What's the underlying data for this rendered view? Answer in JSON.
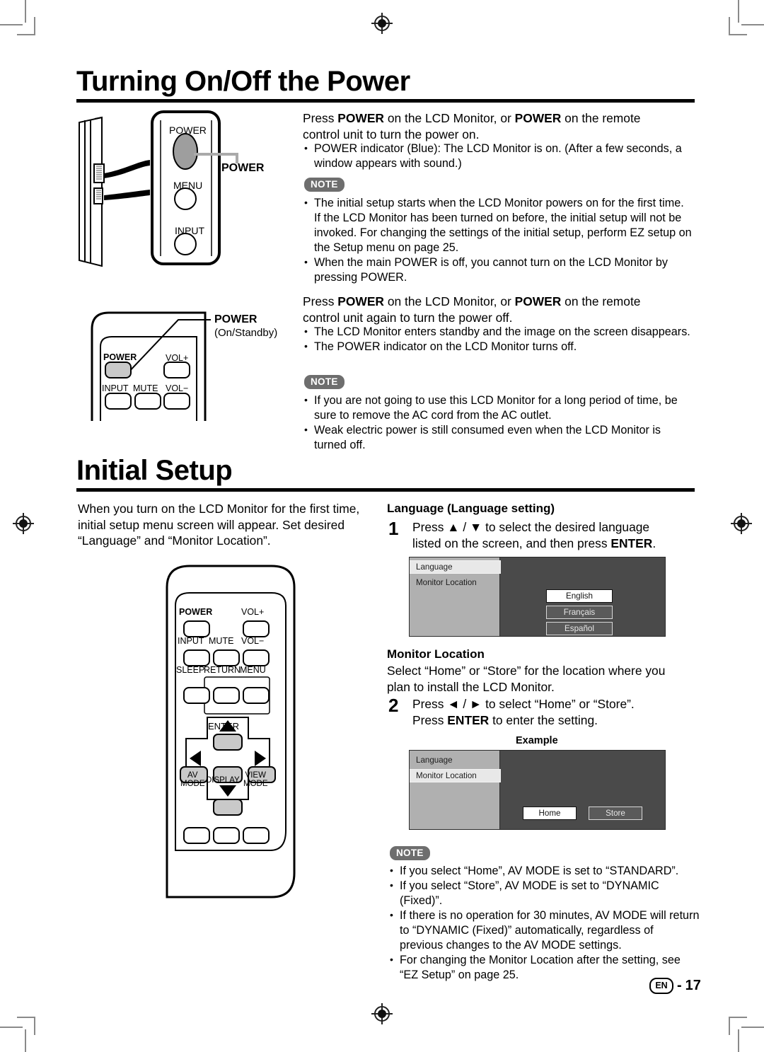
{
  "page": {
    "footer_locale": "EN",
    "footer_page": "17"
  },
  "section1": {
    "title": "Turning On/Off the Power",
    "para_on": {
      "l1_a": "Press ",
      "l1_b": "POWER",
      "l1_c": " on the LCD Monitor, or ",
      "l1_d": "POWER",
      "l1_e": " on the remote",
      "l2": "control unit to turn the power on."
    },
    "bullets_on": [
      "POWER indicator (Blue): The LCD Monitor is on. (After a few seconds, a window appears with sound.)"
    ],
    "note1_label": "NOTE",
    "note1_bullets": [
      "The initial setup starts when the LCD Monitor powers on for the first time. If the LCD Monitor has been turned on before, the initial setup will not be invoked. For changing the settings of the initial setup, perform EZ setup on the Setup menu on page 25.",
      "When the main POWER is off, you cannot turn on the LCD Monitor by pressing POWER."
    ],
    "para_off": {
      "l1_a": "Press ",
      "l1_b": "POWER",
      "l1_c": " on the LCD Monitor, or ",
      "l1_d": "POWER",
      "l1_e": " on the remote",
      "l2": "control unit again to turn the power off."
    },
    "bullets_off": [
      "The LCD Monitor enters standby and the image on the screen disappears.",
      "The POWER indicator on the LCD Monitor turns off."
    ],
    "note2_label": "NOTE",
    "note2_bullets": [
      "If you are not going to use this LCD Monitor for a long period of time, be sure to remove the AC cord from the AC outlet.",
      "Weak electric power is still consumed even when the LCD Monitor is turned off."
    ]
  },
  "monitor_panel": {
    "btn_power": "POWER",
    "btn_menu": "MENU",
    "btn_input": "INPUT",
    "callout_power": "POWER"
  },
  "remote_small": {
    "callout_title": "POWER",
    "callout_sub": "(On/Standby)",
    "keys": {
      "power": "POWER",
      "vol_plus": "VOL+",
      "input": "INPUT",
      "mute": "MUTE",
      "vol_minus": "VOL−"
    }
  },
  "remote_large": {
    "keys": {
      "power": "POWER",
      "vol_plus": "VOL+",
      "input": "INPUT",
      "mute": "MUTE",
      "vol_minus": "VOL−",
      "sleep": "SLEEP",
      "return": "RETURN",
      "menu": "MENU",
      "enter": "ENTER",
      "av_mode_l1": "AV",
      "av_mode_l2": "MODE",
      "display": "DISPLAY",
      "view_mode_l1": "VIEW",
      "view_mode_l2": "MODE"
    }
  },
  "section2": {
    "title": "Initial Setup",
    "intro_l1": "When you turn on the LCD Monitor for the first time,",
    "intro_l2": "initial setup menu screen will appear. Set desired",
    "intro_l3": "“Language” and “Monitor Location”.",
    "language": {
      "heading": "Language (Language setting)",
      "step_num": "1",
      "step_l1_a": "Press ",
      "step_l1_up": "▲",
      "step_l1_sep": " / ",
      "step_l1_dn": "▼",
      "step_l1_b": " to select the desired language",
      "step_l2_a": "listed on the screen, and then press ",
      "step_l2_b": "ENTER",
      "step_l2_c": ".",
      "osd": {
        "side_items": [
          "Language",
          "Monitor Location"
        ],
        "selected_side": "Language",
        "options": [
          "English",
          "Français",
          "Español"
        ],
        "selected_option": "English"
      }
    },
    "monitor_location": {
      "heading": "Monitor Location",
      "desc_l1": "Select “Home” or “Store” for the location where you",
      "desc_l2": "plan to install the LCD Monitor.",
      "step_num": "2",
      "step_l1_a": "Press ",
      "step_l1_lt": "◄",
      "step_l1_sep": " / ",
      "step_l1_rt": "►",
      "step_l1_b": " to select “Home” or “Store”.",
      "step_l2_a": "Press ",
      "step_l2_b": "ENTER",
      "step_l2_c": " to enter the setting.",
      "example_label": "Example",
      "osd": {
        "side_items": [
          "Language",
          "Monitor Location"
        ],
        "selected_side": "Monitor Location",
        "options": [
          "Home",
          "Store"
        ],
        "selected_option": "Home"
      }
    },
    "note3_label": "NOTE",
    "note3_bullets": [
      "If you select “Home”, AV MODE is set to “STANDARD”.",
      "If you select “Store”, AV MODE is set to “DYNAMIC (Fixed)”.",
      "If there is no operation for 30 minutes, AV MODE will return to “DYNAMIC (Fixed)” automatically, regardless of previous changes to the AV MODE settings.",
      "For changing the Monitor Location after the setting, see “EZ Setup” on page 25."
    ]
  }
}
